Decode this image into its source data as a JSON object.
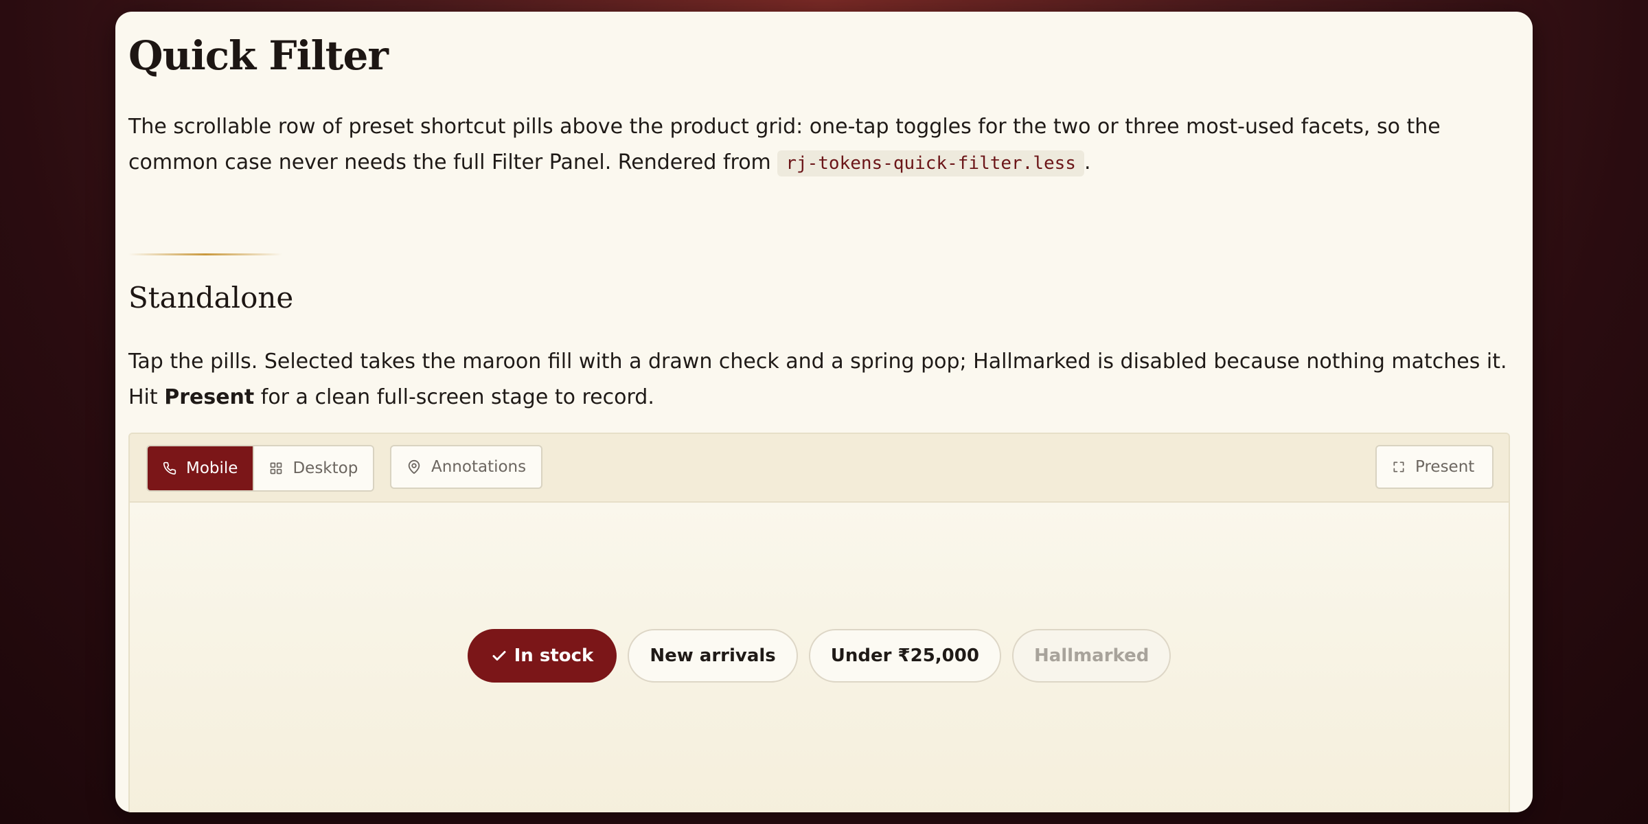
{
  "page": {
    "title": "Quick Filter",
    "intro_text": "The scrollable row of preset shortcut pills above the product grid: one-tap toggles for the two or three most-used facets, so the common case never needs the full Filter Panel. Rendered from ",
    "intro_code": "rj-tokens-quick-filter.less",
    "intro_end": "."
  },
  "section": {
    "title": "Standalone",
    "desc_text": "Tap the pills. Selected takes the maroon fill with a drawn check and a spring pop; Hallmarked is disabled because nothing matches it. Hit ",
    "desc_bold": "Present",
    "desc_end": " for a clean full-screen stage to record."
  },
  "toolbar": {
    "mobile_label": "Mobile",
    "desktop_label": "Desktop",
    "annotations_label": "Annotations",
    "present_label": "Present",
    "active_view": "Mobile"
  },
  "pills": [
    {
      "label": "In stock",
      "state": "selected"
    },
    {
      "label": "New arrivals",
      "state": "default"
    },
    {
      "label": "Under ₹25,000",
      "state": "default"
    },
    {
      "label": "Hallmarked",
      "state": "disabled"
    }
  ],
  "colors": {
    "accent_maroon": "#7b1618",
    "gold_divider": "#c9983c",
    "card_background": "#fbf8ef",
    "code_text": "#6b1518"
  },
  "icons": {
    "mobile": "phone-icon",
    "desktop": "grid-icon",
    "annotations": "map-pin-icon",
    "present": "expand-icon",
    "selected_pill": "check-icon"
  }
}
